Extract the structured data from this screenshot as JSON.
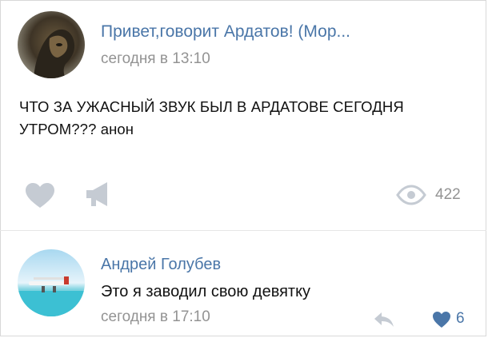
{
  "post": {
    "author": "Привет,говорит Ардатов! (Мор...",
    "time": "сегодня в 13:10",
    "text": "ЧТО ЗА УЖАСНЫЙ ЗВУК БЫЛ В АРДАТОВЕ СЕГОДНЯ УТРОМ??? анон",
    "views": "422",
    "icons": [
      "avatar",
      "like-icon",
      "share-icon",
      "eye-icon"
    ]
  },
  "comment": {
    "author": "Андрей Голубев",
    "text": "Это я заводил свою девятку",
    "time": "сегодня в 17:10",
    "likes": "6",
    "icons": [
      "avatar",
      "reply-icon",
      "heart-icon"
    ]
  },
  "colors": {
    "link": "#4a76a8",
    "muted": "#939393",
    "icon_gray": "#c5cbd3",
    "text": "#111111"
  }
}
